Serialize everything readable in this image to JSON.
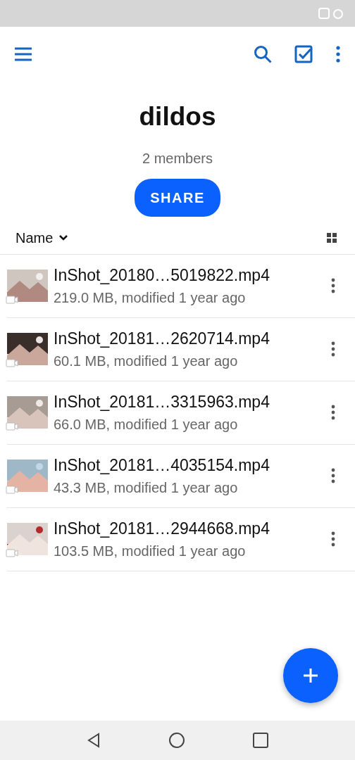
{
  "toolbar": {
    "title": "dildos",
    "subtitle": "2 members",
    "share_button": "SHARE"
  },
  "sort": {
    "label": "Name"
  },
  "files": [
    {
      "name": "InShot_20180…5019822.mp4",
      "details": "219.0 MB, modified 1 year ago",
      "kind": "picture"
    },
    {
      "name": "InShot_20181…2620714.mp4",
      "details": "60.1 MB, modified 1 year ago",
      "kind": "picture"
    },
    {
      "name": "InShot_20181…3315963.mp4",
      "details": "66.0 MB, modified 1 year ago",
      "kind": "picture"
    },
    {
      "name": "InShot_20181…4035154.mp4",
      "details": "43.3 MB, modified 1 year ago",
      "kind": "picture"
    },
    {
      "name": "InShot_20181…2944668.mp4",
      "details": "103.5 MB, modified 1 year ago",
      "kind": "picture"
    }
  ]
}
